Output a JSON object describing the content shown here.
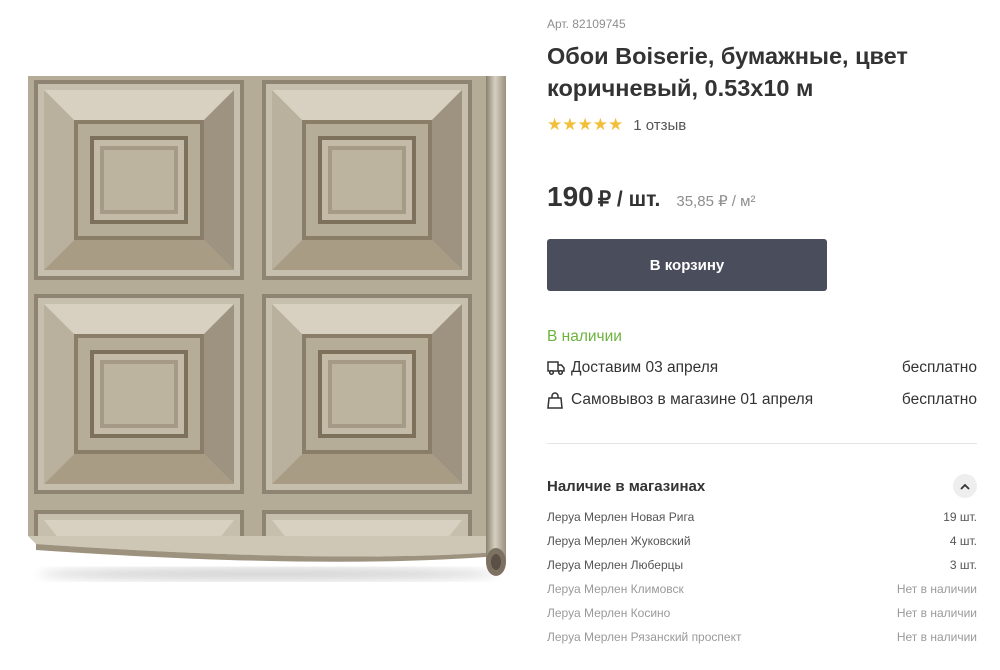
{
  "product": {
    "article": "Арт. 82109745",
    "title": "Обои Boiserie, бумажные, цвет коричневый, 0.53x10 м",
    "rating": {
      "stars": 5,
      "stars_display": "★★★★★",
      "reviews": "1 отзыв"
    },
    "price": {
      "value": "190",
      "unit": "₽ / шт.",
      "per_m2": "35,85 ₽ / м²"
    },
    "cart_button": "В корзину"
  },
  "availability": {
    "status": "В наличии",
    "delivery": [
      {
        "icon": "truck-icon",
        "text": "Доставим 03 апреля",
        "price": "бесплатно"
      },
      {
        "icon": "bag-icon",
        "text": "Самовывоз в магазине 01 апреля",
        "price": "бесплатно"
      }
    ]
  },
  "stores": {
    "title": "Наличие в магазинах",
    "items": [
      {
        "name": "Леруа Мерлен Новая Рига",
        "qty": "19 шт.",
        "in_stock": true
      },
      {
        "name": "Леруа Мерлен Жуковский",
        "qty": "4 шт.",
        "in_stock": true
      },
      {
        "name": "Леруа Мерлен Люберцы",
        "qty": "3 шт.",
        "in_stock": true
      },
      {
        "name": "Леруа Мерлен Климовск",
        "qty": "Нет в наличии",
        "in_stock": false
      },
      {
        "name": "Леруа Мерлен Косино",
        "qty": "Нет в наличии",
        "in_stock": false
      },
      {
        "name": "Леруа Мерлен Рязанский проспект",
        "qty": "Нет в наличии",
        "in_stock": false
      }
    ]
  },
  "colors": {
    "accent_dark": "#4a4e5c",
    "in_stock_green": "#6cb33f",
    "star_gold": "#f1bf3a"
  }
}
